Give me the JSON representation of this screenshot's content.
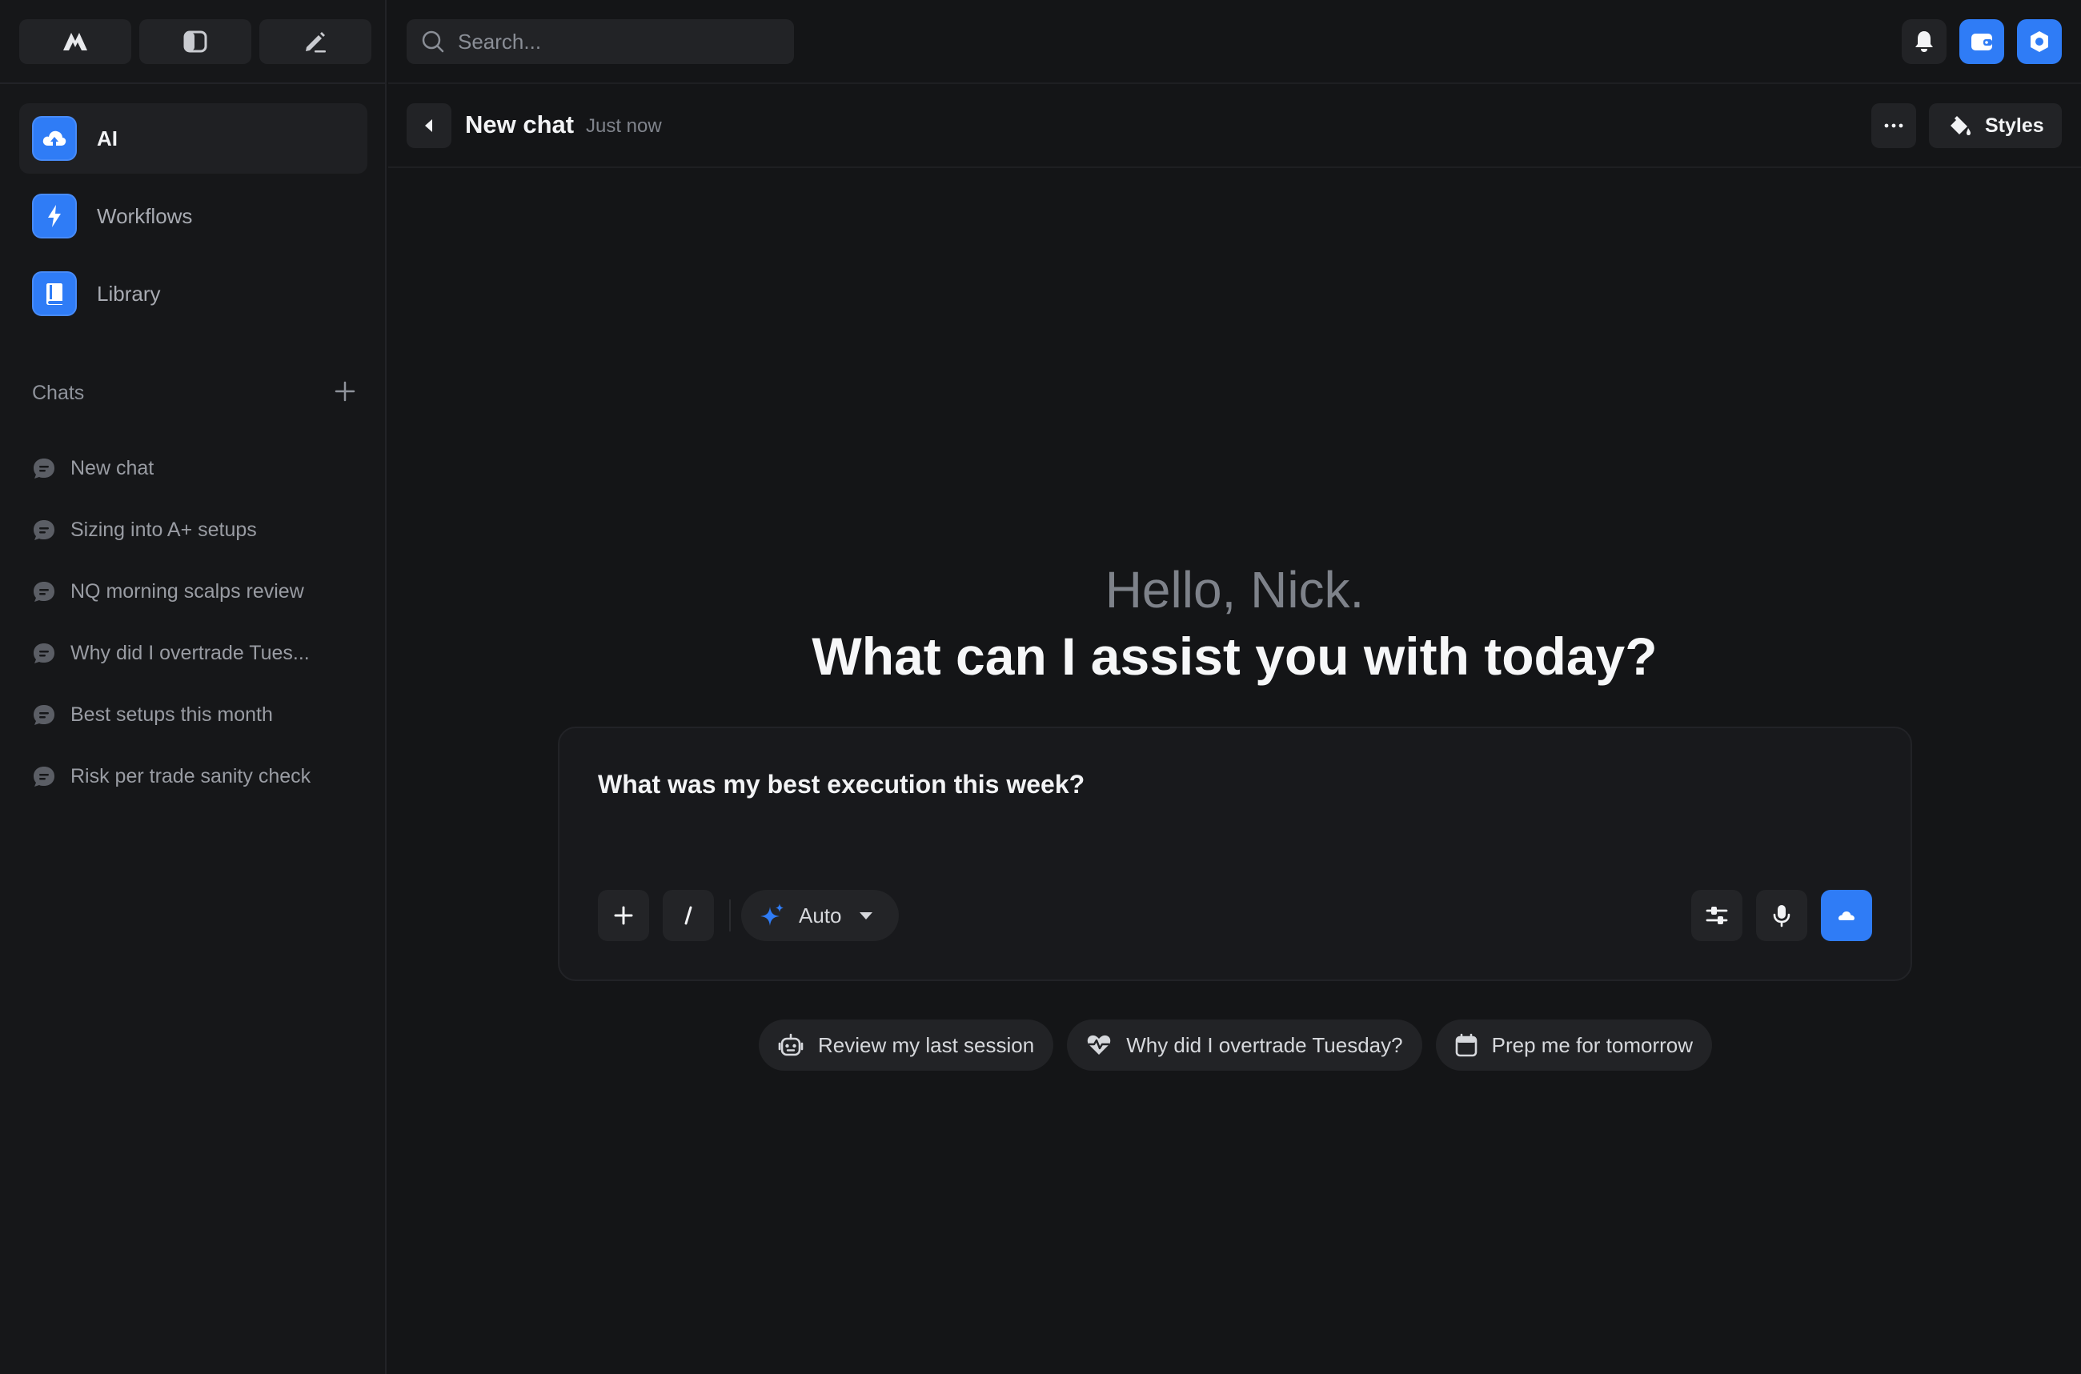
{
  "colors": {
    "accent": "#2f7cf6",
    "background": "#141517",
    "sidebar": "#161719"
  },
  "toolbar": {
    "tools": [
      {
        "icon": "logo-icon"
      },
      {
        "icon": "panel-toggle-icon"
      },
      {
        "icon": "pencil-icon"
      }
    ]
  },
  "sidebar": {
    "nav": [
      {
        "label": "AI",
        "icon": "ai-cloud-icon",
        "active": true
      },
      {
        "label": "Workflows",
        "icon": "lightning-icon",
        "active": false
      },
      {
        "label": "Library",
        "icon": "book-icon",
        "active": false
      }
    ],
    "chats_title": "Chats",
    "chats": [
      "New chat",
      "Sizing into A+ setups",
      "NQ morning scalps review",
      "Why did I overtrade Tues...",
      "Best setups this month",
      "Risk per trade sanity check"
    ]
  },
  "search": {
    "placeholder": "Search..."
  },
  "header": {
    "title": "New chat",
    "time": "Just now",
    "more_label": "···",
    "styles_label": "Styles"
  },
  "hero": {
    "greeting": "Hello, Nick.",
    "headline": "What can I assist you with today?"
  },
  "composer": {
    "text": "What was my best execution this week?",
    "add_label": "+",
    "slash_label": "/",
    "model": "Auto"
  },
  "suggestions": [
    {
      "label": "Review my last session",
      "icon": "robot-icon"
    },
    {
      "label": "Why did I overtrade Tuesday?",
      "icon": "heartbeat-icon"
    },
    {
      "label": "Prep me for tomorrow",
      "icon": "calendar-icon"
    }
  ]
}
